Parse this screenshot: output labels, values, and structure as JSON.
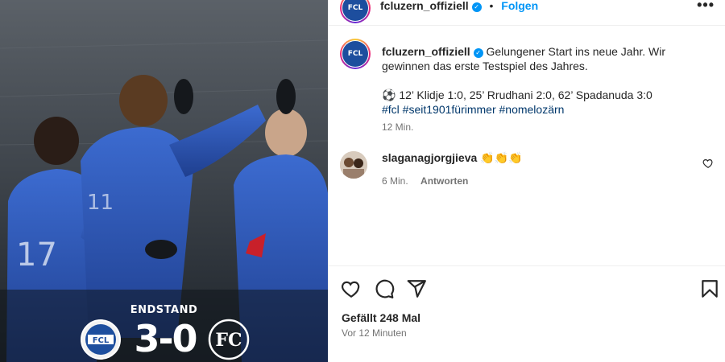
{
  "post": {
    "score": "3-0",
    "endstand_label": "ENDSTAND",
    "home_logo_text": "FCL",
    "away_logo_text": "FC"
  },
  "header": {
    "username": "fcluzern_offiziell",
    "follow_label": "Folgen",
    "more_label": "•••"
  },
  "caption": {
    "username": "fcluzern_offiziell",
    "text": "Gelungener Start ins neue Jahr. Wir gewinnen das erste Testspiel des Jahres.",
    "goals": "⚽ 12’ Klidje 1:0, 25’ Rrudhani 2:0, 62’ Spadanuda 3:0",
    "hashtags": "#fcl #seit1901fürimmer #nomelozärn",
    "time": "12 Min."
  },
  "comment": {
    "username": "slaganagjorgjieva",
    "text": "👏👏👏",
    "time": "6 Min.",
    "reply_label": "Antworten"
  },
  "footer": {
    "likes": "Gefällt 248 Mal",
    "time_ago": "Vor 12 Minuten"
  },
  "colors": {
    "accent": "#0095f6",
    "hashtag": "#00376b",
    "club_blue": "#1d4e9e",
    "muted": "#737373"
  },
  "icons": [
    "heart-icon",
    "comment-icon",
    "share-icon",
    "bookmark-icon",
    "verified-icon",
    "more-icon"
  ]
}
